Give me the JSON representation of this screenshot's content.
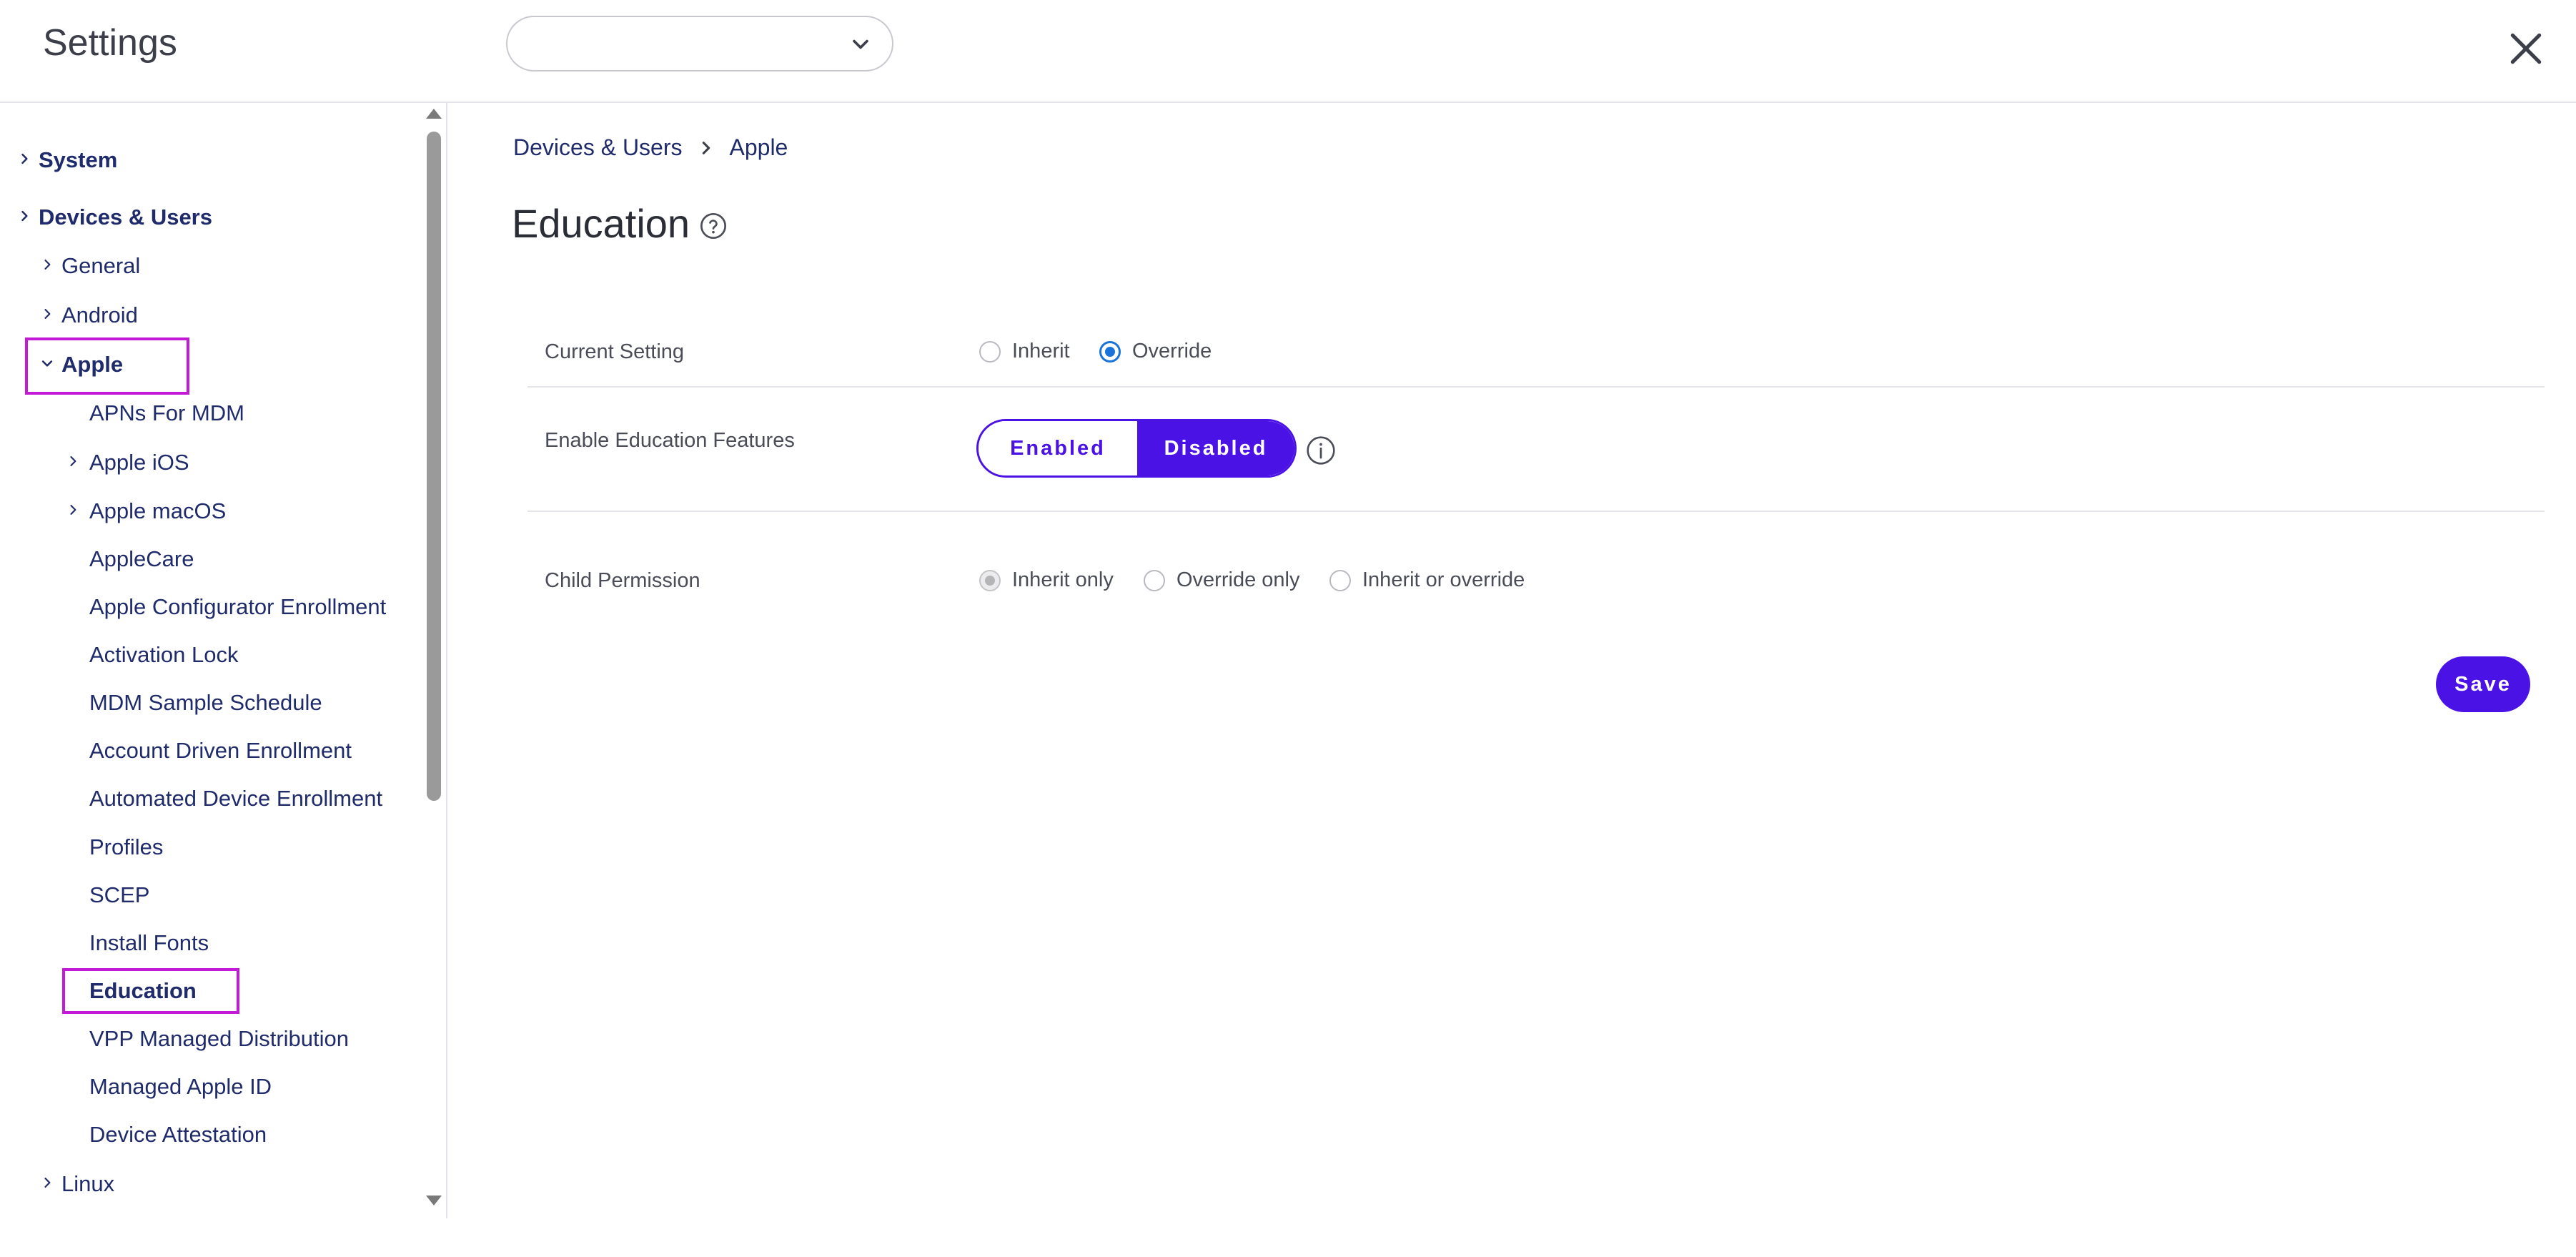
{
  "app": {
    "title": "Settings"
  },
  "sidebar": {
    "items": [
      {
        "label": "System"
      },
      {
        "label": "Devices & Users"
      },
      {
        "label": "General"
      },
      {
        "label": "Android"
      },
      {
        "label": "Apple"
      },
      {
        "label": "APNs For MDM"
      },
      {
        "label": "Apple iOS"
      },
      {
        "label": "Apple macOS"
      },
      {
        "label": "AppleCare"
      },
      {
        "label": "Apple Configurator Enrollment"
      },
      {
        "label": "Activation Lock"
      },
      {
        "label": "MDM Sample Schedule"
      },
      {
        "label": "Account Driven Enrollment"
      },
      {
        "label": "Automated Device Enrollment"
      },
      {
        "label": "Profiles"
      },
      {
        "label": "SCEP"
      },
      {
        "label": "Install Fonts"
      },
      {
        "label": "Education"
      },
      {
        "label": "VPP Managed Distribution"
      },
      {
        "label": "Managed Apple ID"
      },
      {
        "label": "Device Attestation"
      },
      {
        "label": "Linux"
      }
    ]
  },
  "breadcrumb": {
    "items": [
      "Devices & Users",
      "Apple"
    ]
  },
  "main": {
    "title": "Education",
    "current_setting": {
      "label": "Current Setting",
      "options": [
        "Inherit",
        "Override"
      ],
      "selected": "Override"
    },
    "education_features": {
      "label": "Enable Education Features",
      "enabled_label": "Enabled",
      "disabled_label": "Disabled",
      "selected": "Disabled"
    },
    "child_permission": {
      "label": "Child Permission",
      "options": [
        "Inherit only",
        "Override only",
        "Inherit or override"
      ],
      "selected": "Inherit only"
    },
    "save_label": "Save"
  },
  "colors": {
    "accent": "#4b12e6",
    "nav_text": "#1f2b6b",
    "highlight_box": "#c31ad8",
    "radio_selected": "#1a73d9"
  },
  "icons": {
    "close": "close-icon",
    "dropdown": "chevron-down-icon",
    "help": "help-circle-icon",
    "info": "info-icon",
    "expand": "chevron-right-icon",
    "collapse": "chevron-down-icon"
  }
}
